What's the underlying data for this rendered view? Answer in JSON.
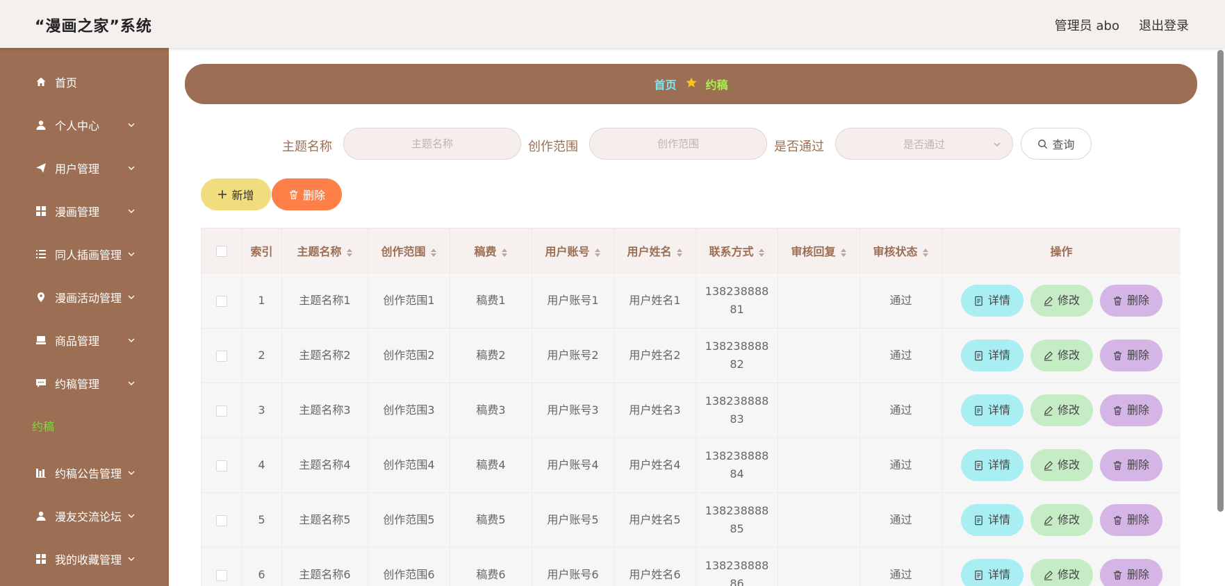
{
  "header": {
    "title": "“漫画之家”系统",
    "user": "管理员 abo",
    "logout": "退出登录"
  },
  "sidebar": {
    "items": [
      {
        "label": "首页",
        "icon": "home-icon"
      },
      {
        "label": "个人中心",
        "icon": "user-icon"
      },
      {
        "label": "用户管理",
        "icon": "send-icon"
      },
      {
        "label": "漫画管理",
        "icon": "grid-icon"
      },
      {
        "label": "同人插画管理",
        "icon": "list-icon"
      },
      {
        "label": "漫画活动管理",
        "icon": "location-icon"
      },
      {
        "label": "商品管理",
        "icon": "goods-icon"
      },
      {
        "label": "约稿管理",
        "icon": "chat-icon"
      },
      {
        "label": "约稿公告管理",
        "icon": "chart-icon"
      },
      {
        "label": "漫友交流论坛",
        "icon": "user-icon"
      },
      {
        "label": "我的收藏管理",
        "icon": "grid-icon"
      }
    ],
    "active_sub": "约稿"
  },
  "breadcrumb": {
    "home": "首页",
    "current": "约稿"
  },
  "search": {
    "theme_label": "主题名称",
    "theme_placeholder": "主题名称",
    "scope_label": "创作范围",
    "scope_placeholder": "创作范围",
    "pass_label": "是否通过",
    "pass_placeholder": "是否通过",
    "query": "查询"
  },
  "actions": {
    "add": "新增",
    "delete": "删除"
  },
  "table": {
    "headers": [
      "索引",
      "主题名称",
      "创作范围",
      "稿费",
      "用户账号",
      "用户姓名",
      "联系方式",
      "审核回复",
      "审核状态",
      "操作"
    ],
    "rows": [
      {
        "index": "1",
        "theme": "主题名称1",
        "scope": "创作范围1",
        "fee": "稿费1",
        "account": "用户账号1",
        "name": "用户姓名1",
        "contact": "13823888881",
        "reply": "",
        "status": "通过"
      },
      {
        "index": "2",
        "theme": "主题名称2",
        "scope": "创作范围2",
        "fee": "稿费2",
        "account": "用户账号2",
        "name": "用户姓名2",
        "contact": "13823888882",
        "reply": "",
        "status": "通过"
      },
      {
        "index": "3",
        "theme": "主题名称3",
        "scope": "创作范围3",
        "fee": "稿费3",
        "account": "用户账号3",
        "name": "用户姓名3",
        "contact": "13823888883",
        "reply": "",
        "status": "通过"
      },
      {
        "index": "4",
        "theme": "主题名称4",
        "scope": "创作范围4",
        "fee": "稿费4",
        "account": "用户账号4",
        "name": "用户姓名4",
        "contact": "13823888884",
        "reply": "",
        "status": "通过"
      },
      {
        "index": "5",
        "theme": "主题名称5",
        "scope": "创作范围5",
        "fee": "稿费5",
        "account": "用户账号5",
        "name": "用户姓名5",
        "contact": "13823888885",
        "reply": "",
        "status": "通过"
      },
      {
        "index": "6",
        "theme": "主题名称6",
        "scope": "创作范围6",
        "fee": "稿费6",
        "account": "用户账号6",
        "name": "用户姓名6",
        "contact": "13823888886",
        "reply": "",
        "status": "通过"
      }
    ],
    "row_actions": {
      "detail": "详情",
      "edit": "修改",
      "delete": "删除"
    }
  },
  "colors": {
    "sidebar_bg": "#9c6e53",
    "accent_green": "#7ddc3c",
    "breadcrumb_home": "#7fe6ef",
    "add_button": "#efdd7e",
    "delete_button": "#ff7f48",
    "detail_button": "#a9eef2",
    "edit_button": "#c6ecc6",
    "row_delete_button": "#d5b5e6"
  }
}
